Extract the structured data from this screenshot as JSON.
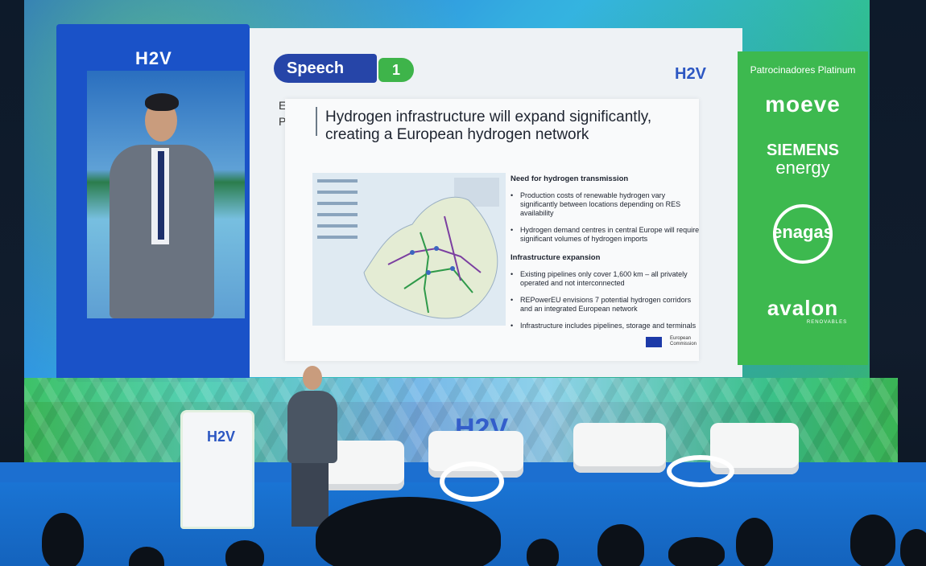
{
  "screen": {
    "panel_logo": "H2V",
    "slide": {
      "speech_label": "Speech",
      "speech_number": "1",
      "logo": "H2V",
      "partial_letters": [
        "E",
        "P"
      ],
      "title": "Hydrogen infrastructure will expand significantly, creating a European hydrogen network",
      "sections": [
        {
          "heading": "Need for hydrogen transmission",
          "bullets": [
            "Production costs of renewable hydrogen vary significantly between locations depending on RES availability",
            "Hydrogen demand centres in central Europe will require significant volumes of hydrogen imports"
          ]
        },
        {
          "heading": "Infrastructure expansion",
          "bullets": [
            "Existing pipelines only cover 1,600 km – all privately operated and not interconnected",
            "REPowerEU envisions 7 potential hydrogen corridors and an integrated European network",
            "Infrastructure includes pipelines, storage and terminals"
          ]
        }
      ],
      "source_label": "European Commission"
    },
    "sponsors": {
      "title": "Patrocinadores Platinum",
      "items": [
        "moeve",
        "SIEMENS",
        "energy",
        "enagas",
        "avalon",
        "RENOVABLES"
      ]
    }
  },
  "stage": {
    "wall_logo": "H2V",
    "podium_logo": "H2V"
  },
  "colors": {
    "slide_blue": "#2645a8",
    "accent_green": "#3db94f",
    "h2v_blue": "#2c57c2",
    "stage_floor": "#1a74d4"
  }
}
